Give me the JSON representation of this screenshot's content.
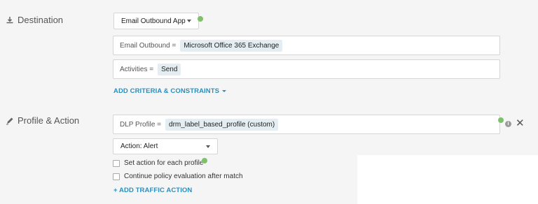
{
  "destination": {
    "label": "Destination",
    "app_select": {
      "value": "Email Outbound App"
    },
    "criteria": [
      {
        "key": "Email Outbound =",
        "value": "Microsoft Office 365 Exchange"
      },
      {
        "key": "Activities =",
        "value": "Send"
      }
    ],
    "add_criteria_label": "ADD CRITERIA & CONSTRAINTS"
  },
  "profile_action": {
    "label": "Profile & Action",
    "dlp_profile": {
      "key": "DLP Profile =",
      "value": "drm_label_based_profile (custom)"
    },
    "action_select": {
      "value": "Action: Alert"
    },
    "checkboxes": [
      {
        "label": "Set action for each profile",
        "checked": false
      },
      {
        "label": "Continue policy evaluation after match",
        "checked": false
      }
    ],
    "add_traffic_label": "+ ADD TRAFFIC ACTION"
  },
  "icons": {
    "destination": "download-icon",
    "profile": "pen-icon",
    "info": "info-icon",
    "close": "close-icon"
  },
  "colors": {
    "accent": "#2a8fbd",
    "status_dot": "#7cc26a",
    "chip": "#e4eef2"
  }
}
